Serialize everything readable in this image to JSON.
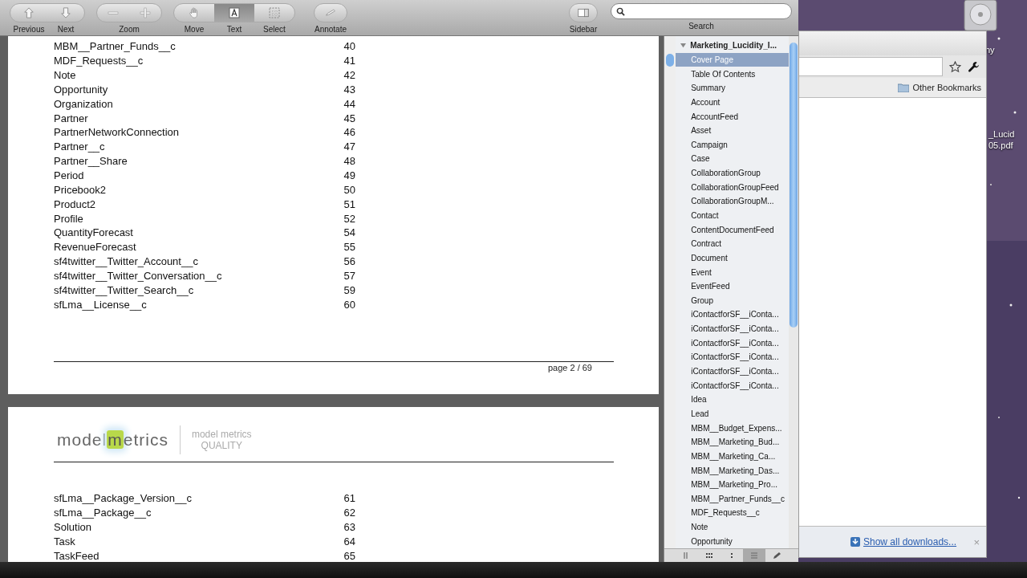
{
  "toolbar": {
    "nav": [
      {
        "label": "Previous",
        "kind": "up"
      },
      {
        "label": "Next",
        "kind": "down"
      }
    ],
    "zoom": {
      "label": "Zoom",
      "buttons": [
        {
          "kind": "minus"
        },
        {
          "kind": "plus"
        }
      ]
    },
    "tools": [
      {
        "label": "Move",
        "kind": "hand",
        "selected": false
      },
      {
        "label": "Text",
        "kind": "text",
        "selected": true
      },
      {
        "label": "Select",
        "kind": "select",
        "selected": false
      }
    ],
    "annotate": {
      "label": "Annotate"
    },
    "sidebar_button": {
      "label": "Sidebar"
    },
    "search": {
      "label": "Search"
    }
  },
  "page1": {
    "rows": [
      {
        "name": "MBM__Partner_Funds__c",
        "page": "40"
      },
      {
        "name": "MDF_Requests__c",
        "page": "41"
      },
      {
        "name": "Note",
        "page": "42"
      },
      {
        "name": "Opportunity",
        "page": "43"
      },
      {
        "name": "Organization",
        "page": "44"
      },
      {
        "name": "Partner",
        "page": "45"
      },
      {
        "name": "PartnerNetworkConnection",
        "page": "46"
      },
      {
        "name": "Partner__c",
        "page": "47"
      },
      {
        "name": "Partner__Share",
        "page": "48"
      },
      {
        "name": "Period",
        "page": "49"
      },
      {
        "name": "Pricebook2",
        "page": "50"
      },
      {
        "name": "Product2",
        "page": "51"
      },
      {
        "name": "Profile",
        "page": "52"
      },
      {
        "name": "QuantityForecast",
        "page": "54"
      },
      {
        "name": "RevenueForecast",
        "page": "55"
      },
      {
        "name": "sf4twitter__Twitter_Account__c",
        "page": "56"
      },
      {
        "name": "sf4twitter__Twitter_Conversation__c",
        "page": "57"
      },
      {
        "name": "sf4twitter__Twitter_Search__c",
        "page": "59"
      },
      {
        "name": "sfLma__License__c",
        "page": "60"
      }
    ],
    "footer": "page 2 / 69"
  },
  "page2": {
    "logo": {
      "before": "model",
      "highlight": "m",
      "after": "etrics",
      "tagline": "model metrics",
      "sub": "QUALITY"
    },
    "rows": [
      {
        "name": "sfLma__Package_Version__c",
        "page": "61"
      },
      {
        "name": "sfLma__Package__c",
        "page": "62"
      },
      {
        "name": "Solution",
        "page": "63"
      },
      {
        "name": "Task",
        "page": "64"
      },
      {
        "name": "TaskFeed",
        "page": "65"
      }
    ]
  },
  "sidebar": {
    "document": {
      "title": "Marketing_Lucidity_I...",
      "expanded": true
    },
    "items": [
      {
        "label": "Cover Page",
        "selected": true
      },
      {
        "label": "Table Of Contents",
        "selected": false
      },
      {
        "label": "Summary",
        "selected": false
      },
      {
        "label": "Account",
        "selected": false
      },
      {
        "label": "AccountFeed",
        "selected": false
      },
      {
        "label": "Asset",
        "selected": false
      },
      {
        "label": "Campaign",
        "selected": false
      },
      {
        "label": "Case",
        "selected": false
      },
      {
        "label": "CollaborationGroup",
        "selected": false
      },
      {
        "label": "CollaborationGroupFeed",
        "selected": false
      },
      {
        "label": "CollaborationGroupM...",
        "selected": false
      },
      {
        "label": "Contact",
        "selected": false
      },
      {
        "label": "ContentDocumentFeed",
        "selected": false
      },
      {
        "label": "Contract",
        "selected": false
      },
      {
        "label": "Document",
        "selected": false
      },
      {
        "label": "Event",
        "selected": false
      },
      {
        "label": "EventFeed",
        "selected": false
      },
      {
        "label": "Group",
        "selected": false
      },
      {
        "label": "iContactforSF__iConta...",
        "selected": false
      },
      {
        "label": "iContactforSF__iConta...",
        "selected": false
      },
      {
        "label": "iContactforSF__iConta...",
        "selected": false
      },
      {
        "label": "iContactforSF__iConta...",
        "selected": false
      },
      {
        "label": "iContactforSF__iConta...",
        "selected": false
      },
      {
        "label": "iContactforSF__iConta...",
        "selected": false
      },
      {
        "label": "Idea",
        "selected": false
      },
      {
        "label": "Lead",
        "selected": false
      },
      {
        "label": "MBM__Budget_Expens...",
        "selected": false
      },
      {
        "label": "MBM__Marketing_Bud...",
        "selected": false
      },
      {
        "label": "MBM__Marketing_Ca...",
        "selected": false
      },
      {
        "label": "MBM__Marketing_Das...",
        "selected": false
      },
      {
        "label": "MBM__Marketing_Pro...",
        "selected": false
      },
      {
        "label": "MBM__Partner_Funds__c",
        "selected": false
      },
      {
        "label": "MDF_Requests__c",
        "selected": false
      },
      {
        "label": "Note",
        "selected": false
      },
      {
        "label": "Opportunity",
        "selected": false
      }
    ],
    "views": [
      {
        "kind": "columns",
        "selected": false
      },
      {
        "kind": "grid",
        "selected": false
      },
      {
        "kind": "dots",
        "selected": false
      },
      {
        "kind": "list",
        "selected": true
      },
      {
        "kind": "pen",
        "selected": false
      }
    ]
  },
  "browser": {
    "bookmark": "Other Bookmarks",
    "downloads_link": "Show all downloads...",
    "close": "×"
  },
  "desktop": {
    "labels": [
      "ny",
      "_Lucid",
      "05.pdf"
    ]
  }
}
